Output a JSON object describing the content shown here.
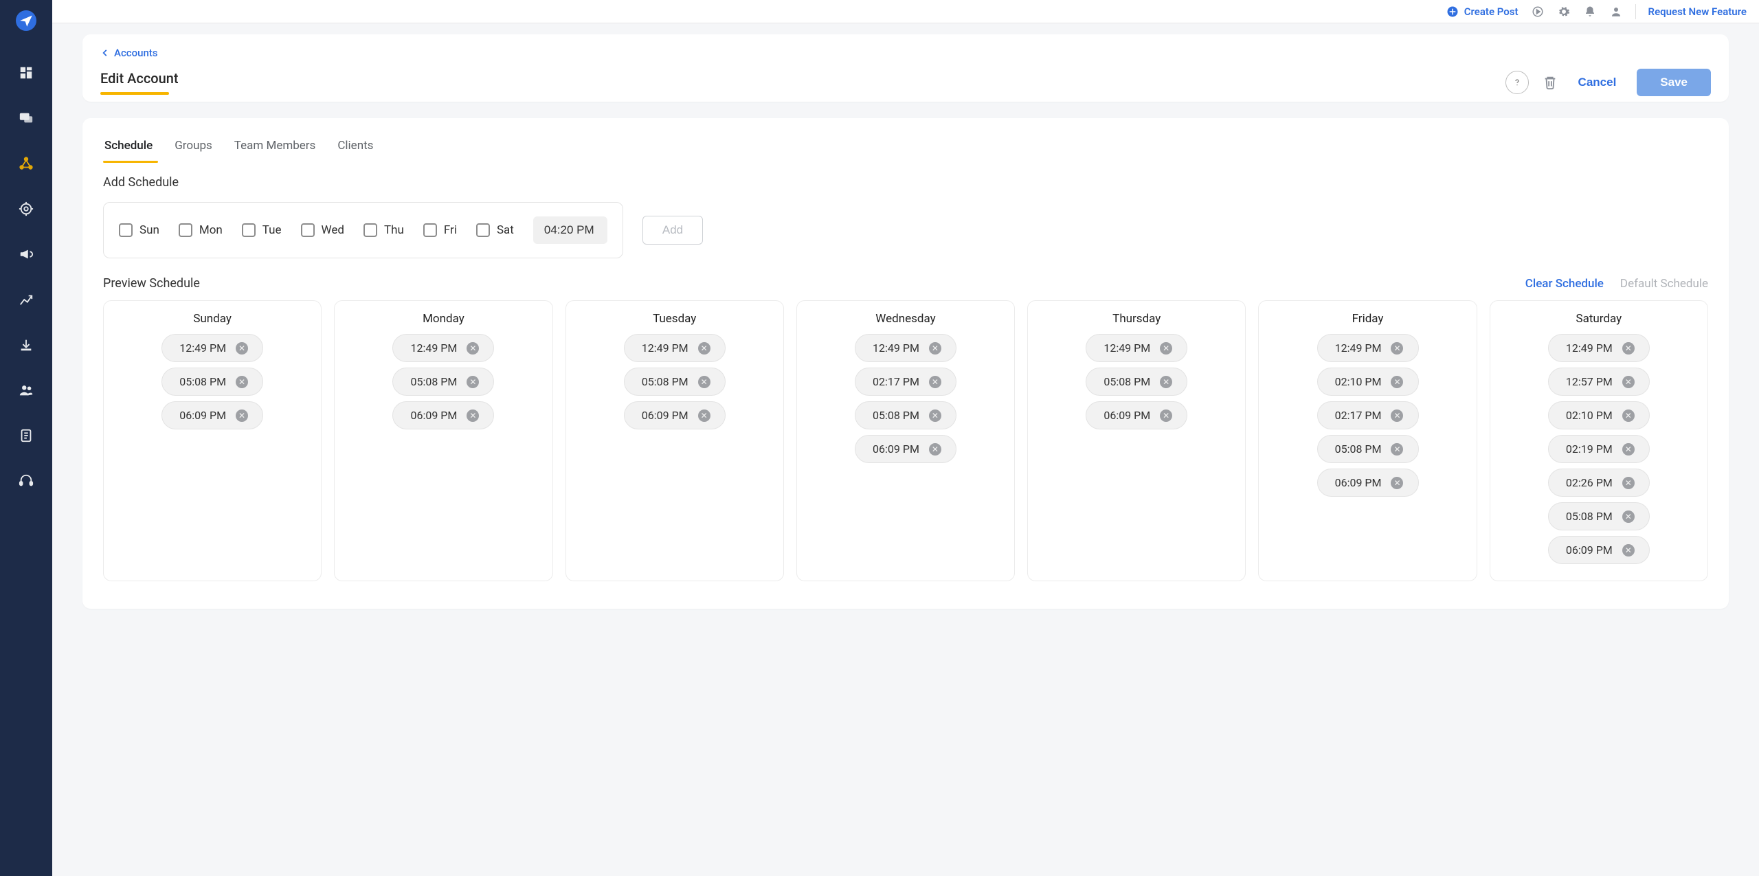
{
  "brand": {
    "logo_name": "paper-plane-icon"
  },
  "sidebar_items": [
    {
      "name": "dashboard-icon"
    },
    {
      "name": "comments-icon"
    },
    {
      "name": "network-icon"
    },
    {
      "name": "target-icon"
    },
    {
      "name": "megaphone-icon"
    },
    {
      "name": "analytics-icon"
    },
    {
      "name": "download-icon"
    },
    {
      "name": "team-icon"
    },
    {
      "name": "document-icon"
    },
    {
      "name": "support-icon"
    }
  ],
  "topbar": {
    "create_post_label": "Create Post",
    "request_feature_label": "Request New Feature"
  },
  "breadcrumb": {
    "label": "Accounts"
  },
  "page": {
    "title": "Edit Account"
  },
  "buttons": {
    "cancel": "Cancel",
    "save": "Save",
    "add": "Add"
  },
  "tabs": [
    {
      "label": "Schedule",
      "active": true
    },
    {
      "label": "Groups",
      "active": false
    },
    {
      "label": "Team Members",
      "active": false
    },
    {
      "label": "Clients",
      "active": false
    }
  ],
  "add_schedule": {
    "title": "Add Schedule",
    "days": [
      "Sun",
      "Mon",
      "Tue",
      "Wed",
      "Thu",
      "Fri",
      "Sat"
    ],
    "time_value": "04:20 PM"
  },
  "preview": {
    "title": "Preview Schedule",
    "clear_label": "Clear Schedule",
    "default_label": "Default Schedule",
    "columns": [
      {
        "day": "Sunday",
        "slots": [
          "12:49 PM",
          "05:08 PM",
          "06:09 PM"
        ]
      },
      {
        "day": "Monday",
        "slots": [
          "12:49 PM",
          "05:08 PM",
          "06:09 PM"
        ]
      },
      {
        "day": "Tuesday",
        "slots": [
          "12:49 PM",
          "05:08 PM",
          "06:09 PM"
        ]
      },
      {
        "day": "Wednesday",
        "slots": [
          "12:49 PM",
          "02:17 PM",
          "05:08 PM",
          "06:09 PM"
        ]
      },
      {
        "day": "Thursday",
        "slots": [
          "12:49 PM",
          "05:08 PM",
          "06:09 PM"
        ]
      },
      {
        "day": "Friday",
        "slots": [
          "12:49 PM",
          "02:10 PM",
          "02:17 PM",
          "05:08 PM",
          "06:09 PM"
        ]
      },
      {
        "day": "Saturday",
        "slots": [
          "12:49 PM",
          "12:57 PM",
          "02:10 PM",
          "02:19 PM",
          "02:26 PM",
          "05:08 PM",
          "06:09 PM"
        ]
      }
    ]
  }
}
